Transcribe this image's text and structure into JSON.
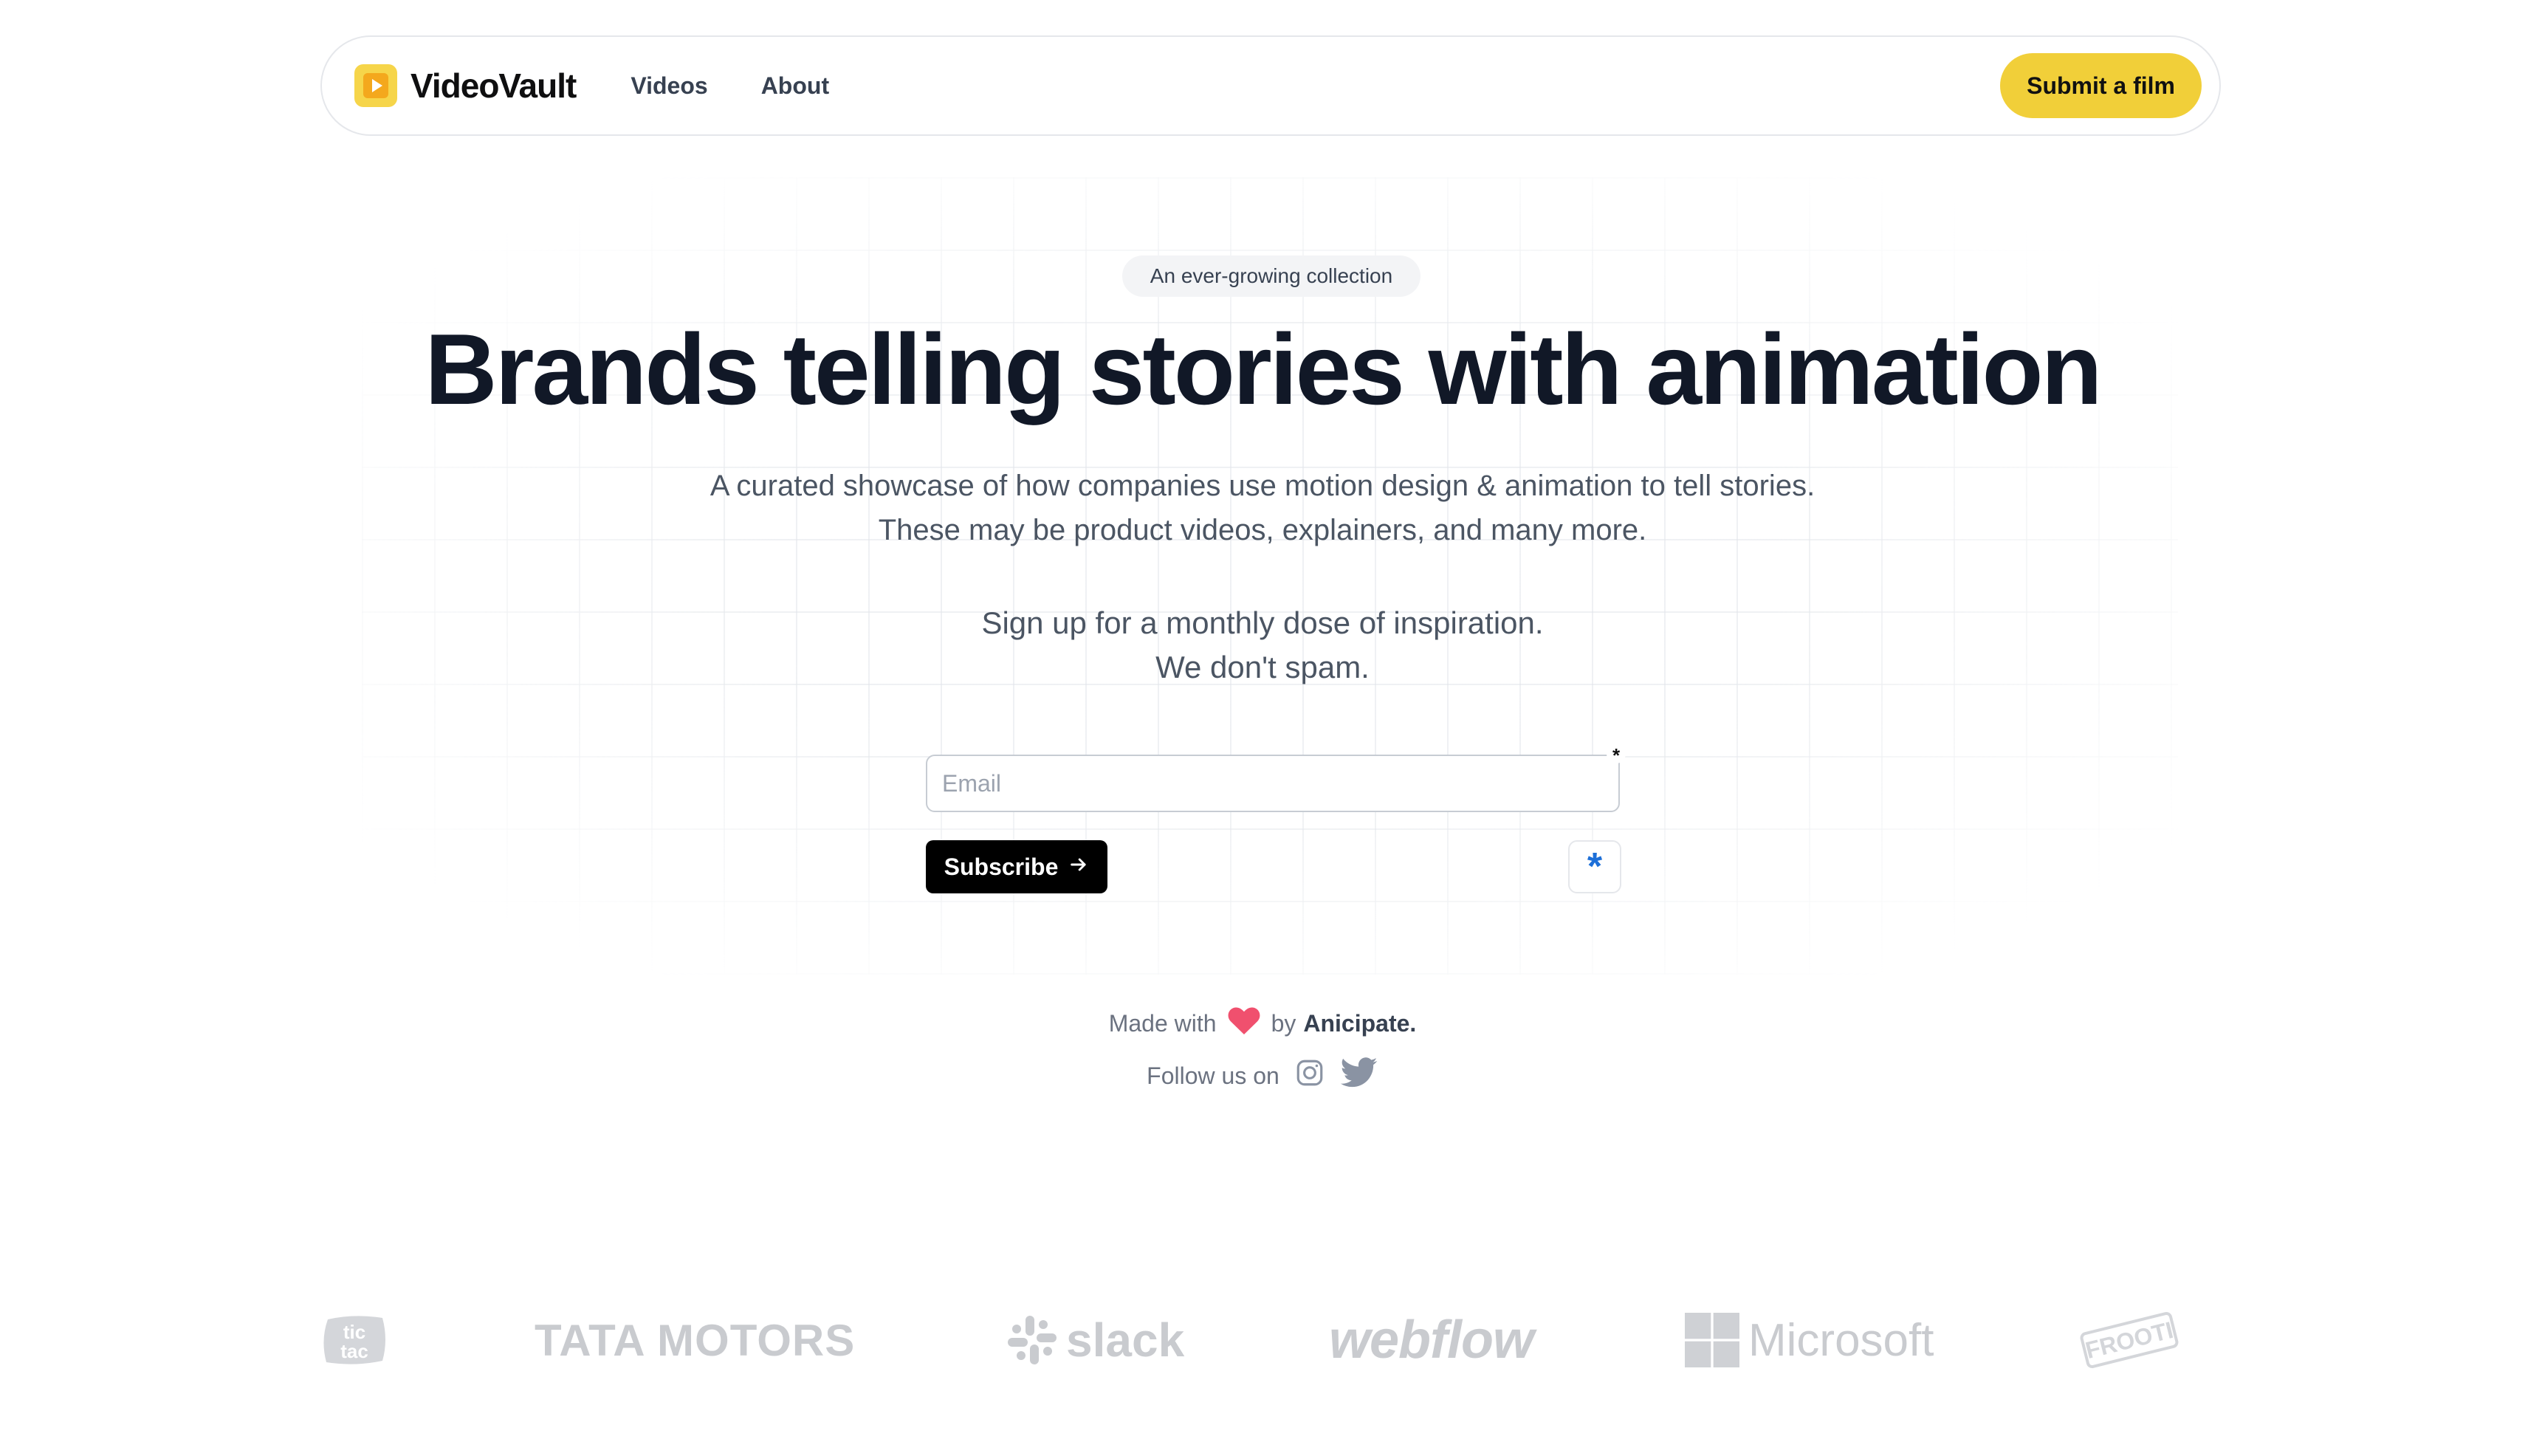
{
  "nav": {
    "brand": "VideoVault",
    "links": [
      "Videos",
      "About"
    ],
    "cta": "Submit a film"
  },
  "hero": {
    "tag": "An ever-growing collection",
    "headline": "Brands telling stories with animation",
    "subtext": "A curated showcase of how companies use motion design & animation to tell stories. These may be product videos, explainers, and many more.",
    "signup_text": "Sign up for a monthly dose of inspiration. We don't spam."
  },
  "form": {
    "email_placeholder": "Email",
    "required_marker": "*",
    "subscribe_label": "Subscribe",
    "captcha_symbol": "*"
  },
  "footer": {
    "made_with_prefix": "Made with",
    "made_with_by": "by",
    "made_with_brand": "Anicipate.",
    "follow_label": "Follow us on"
  },
  "logos": {
    "tictac": "tic tac",
    "tata": "TATA MOTORS",
    "slack": "slack",
    "webflow": "webflow",
    "microsoft": "Microsoft",
    "frooti": "FROOTI"
  },
  "colors": {
    "accent": "#f1cf39",
    "heart": "#f0506e",
    "captcha": "#1d6fd8",
    "logo_gray": "#c9cbcf"
  },
  "icons": {
    "brand": "play-icon",
    "subscribe": "arrow-right-icon",
    "heart": "heart-icon",
    "instagram": "instagram-icon",
    "twitter": "twitter-icon"
  }
}
